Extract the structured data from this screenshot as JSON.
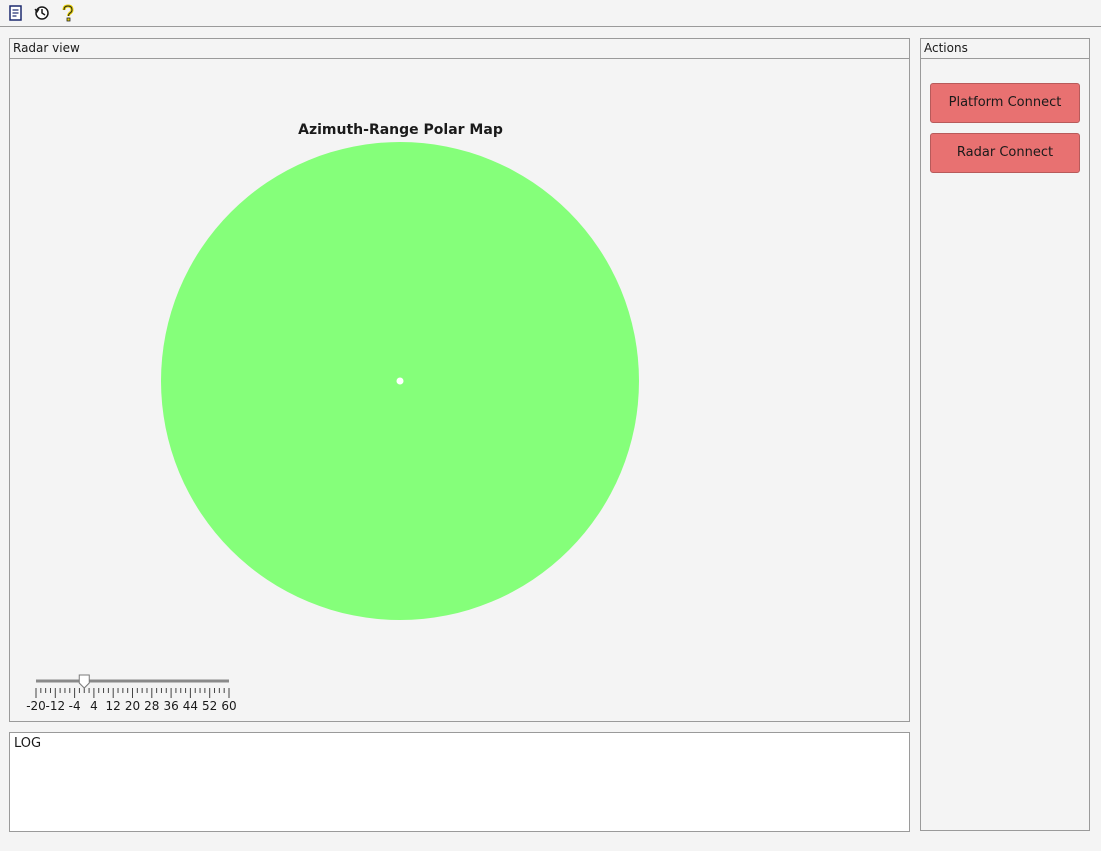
{
  "toolbar": {
    "buttons": [
      {
        "icon": "save-icon"
      },
      {
        "icon": "history-icon"
      },
      {
        "icon": "help-icon"
      }
    ]
  },
  "radar_view": {
    "header": "Radar view",
    "map_title": "Azimuth-Range Polar Map",
    "disc_color": "#85ff7a",
    "center_dot_color": "#ffffff",
    "slider": {
      "min": -20,
      "max": 60,
      "value": 0,
      "tick_labels": [
        "-20",
        "-12",
        "-4",
        "4",
        "12",
        "20",
        "28",
        "36",
        "44",
        "52",
        "60"
      ]
    }
  },
  "actions": {
    "header": "Actions",
    "buttons": [
      {
        "label": "Platform Connect"
      },
      {
        "label": "Radar Connect"
      }
    ],
    "button_color": "#e87171"
  },
  "log": {
    "label": "LOG"
  }
}
